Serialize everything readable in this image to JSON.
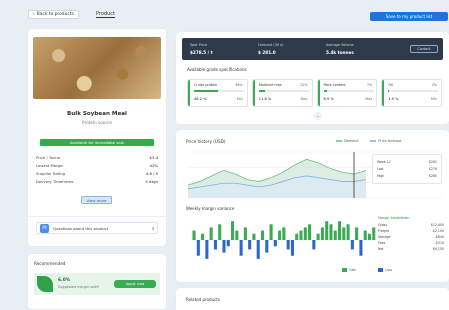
{
  "topbar": {
    "back_label": "Back to products",
    "breadcrumb": "Product",
    "action_label": "Save to my product list"
  },
  "product": {
    "title": "Bulk Soybean Meal",
    "subtitle": "Protein source",
    "status": "Available for immediate sale",
    "rows": [
      {
        "label": "Price / Tonne",
        "value": "$3.4"
      },
      {
        "label": "Lowest Margin",
        "value": "42%"
      },
      {
        "label": "Supplier Rating",
        "value": "4.6 / 5"
      },
      {
        "label": "Delivery Timeframe",
        "value": "5 days"
      }
    ],
    "more_label": "View more",
    "help_label": "Questions about this product",
    "help_count": "3"
  },
  "suggestions": {
    "title": "Recommended",
    "item_title": "6.0%",
    "item_sub": "Suggested margin uplift",
    "item_btn": "Apply now"
  },
  "summary": {
    "cells": [
      {
        "label": "Spot Price",
        "value": "$278.5 / t"
      },
      {
        "label": "Forecast (30 d)",
        "value": "$ 281.0"
      },
      {
        "label": "Average Volume",
        "value": "5.4k tonnes"
      }
    ],
    "button": "Contact",
    "subtitle": "Available grade specifications",
    "specs": [
      {
        "name": "Crude protein",
        "pct": "48%",
        "fill": 0.48,
        "v1": "48.2 %",
        "v2": "Min"
      },
      {
        "name": "Moisture max",
        "pct": "12%",
        "fill": 0.12,
        "v1": "11.8 %",
        "v2": "Max"
      },
      {
        "name": "Fibre content",
        "pct": "7%",
        "fill": 0.07,
        "v1": "6.9 %",
        "v2": "Max"
      },
      {
        "name": "Oil",
        "pct": "2%",
        "fill": 0.02,
        "v1": "1.9 %",
        "v2": "Min"
      }
    ]
  },
  "charts": {
    "line_title": "Price history (USD)",
    "legend_a": "Demand",
    "legend_b": "Price forecast",
    "tip_rows": [
      {
        "k": "Week 12",
        "v": "$281"
      },
      {
        "k": "Low",
        "v": "$276"
      },
      {
        "k": "High",
        "v": "$285"
      }
    ],
    "bar_title": "Weekly margin variance",
    "info_header": "Margin breakdown",
    "info_rows": [
      {
        "k": "Gross",
        "v": "$12,400"
      },
      {
        "k": "Freight",
        "v": "-$2,100"
      },
      {
        "k": "Storage",
        "v": "-$840"
      },
      {
        "k": "Fees",
        "v": "-$310"
      },
      {
        "k": "Net",
        "v": "$9,150"
      }
    ],
    "legend2_a": "Gain",
    "legend2_b": "Loss"
  },
  "bottom": {
    "title": "Related products"
  },
  "chart_data": [
    {
      "type": "area",
      "x": [
        1,
        2,
        3,
        4,
        5,
        6,
        7,
        8,
        9,
        10,
        11,
        12,
        13,
        14,
        15,
        16
      ],
      "series": [
        {
          "name": "Demand",
          "values": [
            272,
            274,
            277,
            280,
            278,
            275,
            274,
            276,
            279,
            283,
            286,
            284,
            281,
            279,
            278,
            280
          ]
        },
        {
          "name": "Price forecast",
          "values": [
            270,
            271,
            272,
            273,
            273,
            272,
            271,
            272,
            274,
            276,
            277,
            276,
            275,
            274,
            274,
            275
          ]
        }
      ],
      "title": "Price history (USD)",
      "ylim": [
        265,
        290
      ],
      "grid": true
    },
    {
      "type": "bar",
      "categories": [
        "1",
        "2",
        "3",
        "4",
        "5",
        "6",
        "7",
        "8",
        "9",
        "10",
        "11",
        "12",
        "13",
        "14",
        "15",
        "16",
        "17",
        "18",
        "19",
        "20",
        "21",
        "22",
        "23",
        "24",
        "25",
        "26",
        "27",
        "28",
        "29",
        "30",
        "31",
        "32",
        "33",
        "34",
        "35",
        "36",
        "37",
        "38",
        "39",
        "40",
        "41",
        "42",
        "43"
      ],
      "series": [
        {
          "name": "Gain",
          "values": [
            3,
            -5,
            2,
            -6,
            4,
            -3,
            5,
            -4,
            -2,
            6,
            3,
            -5,
            4,
            -3,
            2,
            -6,
            3,
            -4,
            5,
            -2,
            3,
            4,
            -3,
            -5,
            2,
            3,
            4,
            5,
            -3,
            2,
            4,
            6,
            5,
            3,
            6,
            4,
            5,
            -3,
            4,
            -5,
            3,
            2,
            4
          ]
        }
      ],
      "title": "Weekly margin variance",
      "ylim": [
        -7,
        7
      ]
    }
  ],
  "colors": {
    "accent": "#1f74d6",
    "success": "#2fae4c",
    "dark_panel": "#2e3a4a",
    "area_a": "#cfe6d7",
    "area_b": "#dceaf7",
    "bar_gain": "#3caa55",
    "bar_loss": "#2f66c9"
  }
}
